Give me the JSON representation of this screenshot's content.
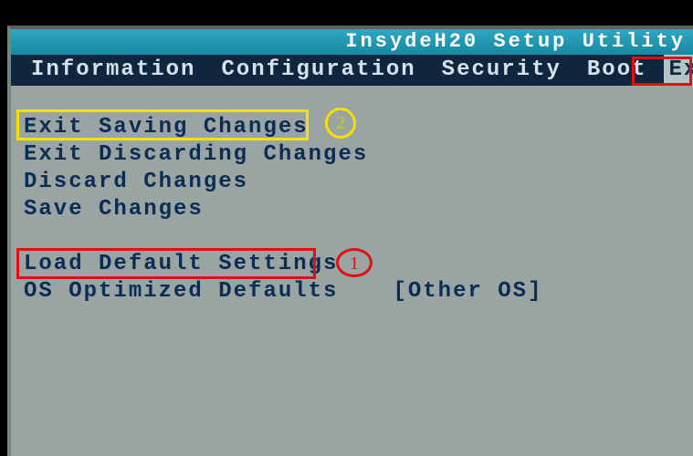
{
  "header": {
    "title": "InsydeH20 Setup Utility"
  },
  "menu": {
    "items": [
      {
        "label": "Information"
      },
      {
        "label": "Configuration"
      },
      {
        "label": "Security"
      },
      {
        "label": "Boot"
      },
      {
        "label": "Exit",
        "active": true
      }
    ]
  },
  "exit_menu": {
    "items": [
      {
        "label": "Exit Saving Changes"
      },
      {
        "label": "Exit Discarding Changes"
      },
      {
        "label": "Discard Changes"
      },
      {
        "label": "Save Changes"
      },
      {
        "label": "Load Default Settings"
      },
      {
        "label": "OS Optimized Defaults",
        "value": "[Other OS]"
      }
    ]
  },
  "annotations": {
    "marker1": "1",
    "marker2": "2"
  }
}
